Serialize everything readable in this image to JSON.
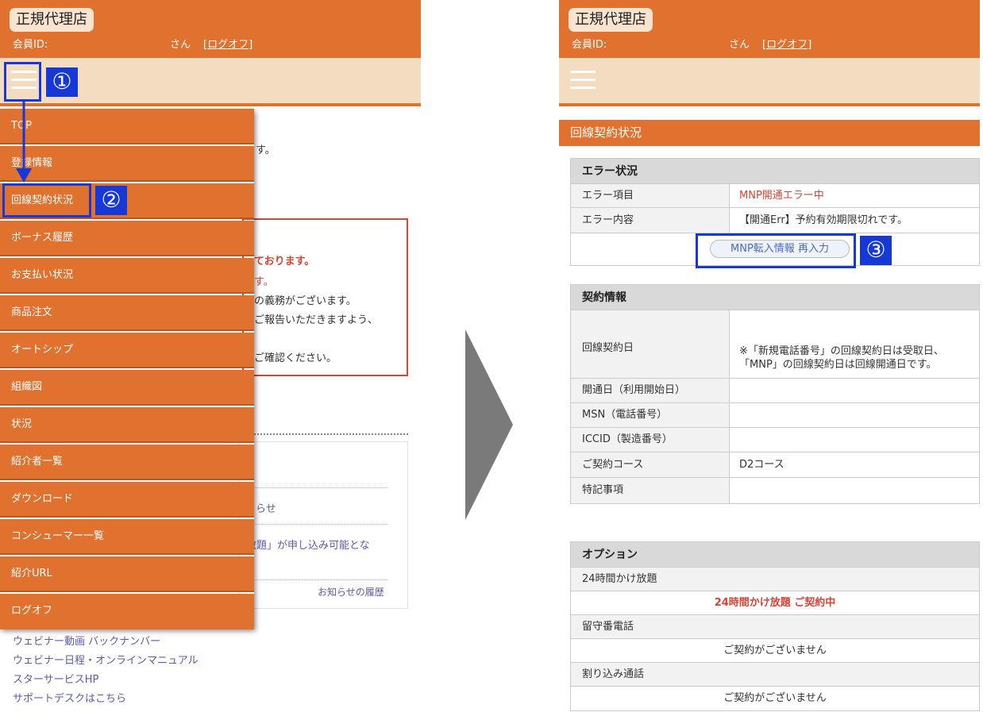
{
  "header": {
    "logo": "正規代理店",
    "member_id_label": "会員ID:",
    "san": "さん",
    "logoff": "[ログオフ]"
  },
  "colors": {
    "accent": "#e0712e",
    "nav_bg": "#f4dcc0",
    "annotation": "#1638d6",
    "error_red": "#d94435"
  },
  "left": {
    "bg_fragments": {
      "f1": "す。",
      "f2": "ております。",
      "f3": "す。",
      "f4": "の義務がございます。",
      "f5": "ご報告いただきますよう、",
      "f6": "ご確認ください。",
      "news1": "らせ",
      "news2": "放題」が申し込み可能とな",
      "news_history": "お知らせの履歴"
    },
    "menu": [
      "TOP",
      "登録情報",
      "回線契約状況",
      "ボーナス履歴",
      "お支払い状況",
      "商品注文",
      "オートシップ",
      "組織図",
      "状況",
      "紹介者一覧",
      "ダウンロード",
      "コンシューマー一覧",
      "紹介URL",
      "ログオフ"
    ],
    "footer_links": [
      "ウェビナー動画 バックナンバー",
      "ウェビナー日程・オンラインマニュアル",
      "スターサービスHP",
      "サポートデスクはこちら"
    ]
  },
  "annotations": {
    "step1": "①",
    "step2": "②",
    "step3": "③"
  },
  "right": {
    "section_title": "回線契約状況",
    "error": {
      "title": "エラー状況",
      "item_label": "エラー項目",
      "item_value": "MNP開通エラー中",
      "content_label": "エラー内容",
      "content_value": "【開通Err】予約有効期限切れです。",
      "button": "MNP転入情報 再入力"
    },
    "contract": {
      "title": "契約情報",
      "date_label": "回線契約日",
      "date_note_1": "※「新規電話番号」の回線契約日は受取日、",
      "date_note_2": "「MNP」の回線契約日は回線開通日です。",
      "open_label": "開通日（利用開始日）",
      "open_value": "",
      "msn_label": "MSN（電話番号）",
      "msn_value": "",
      "iccid_label": "ICCID（製造番号）",
      "iccid_value": "",
      "course_label": "ご契約コース",
      "course_value": "D2コース",
      "notes_label": "特記事項",
      "notes_value": ""
    },
    "options": {
      "title": "オプション",
      "items": [
        {
          "name": "24時間かけ放題",
          "status": "24時間かけ放題 ご契約中"
        },
        {
          "name": "留守番電話",
          "status": "ご契約がございません"
        },
        {
          "name": "割り込み通話",
          "status": "ご契約がございません"
        }
      ]
    }
  }
}
